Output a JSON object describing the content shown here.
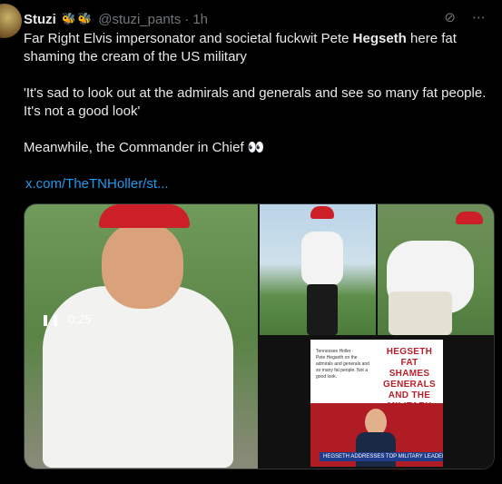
{
  "author": {
    "name": "Stuzi",
    "emoji": "🐝🐝",
    "handle": "@stuzi_pants",
    "separator": "·",
    "time": "1h"
  },
  "header_icons": {
    "grok": "grok-icon",
    "more": "more-icon"
  },
  "tweet": {
    "line1_pre": "Far Right Elvis impersonator and societal fuckwit Pete ",
    "line1_bold": "Hegseth",
    "line1_post": " here fat shaming the cream of the US military",
    "quote": "'It's sad to look out at the admirals and generals and see so many fat people. It's not a good look'",
    "line3": "Meanwhile, the Commander in Chief 👀",
    "link": "x.com/TheTNHoller/st..."
  },
  "media": {
    "video_card_title": "HEGSETH FAT SHAMES GENERALS AND THE MILITARY",
    "video_chyron": "HEGSETH ADDRESSES TOP MILITARY LEADERS",
    "video_time": "0:25"
  }
}
